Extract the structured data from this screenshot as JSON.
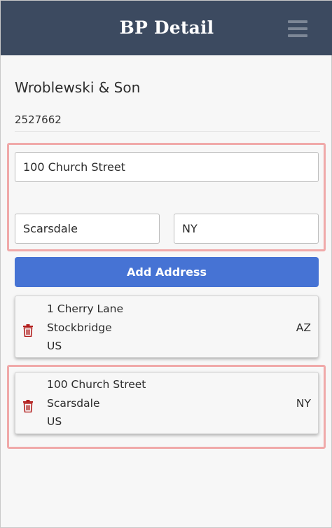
{
  "header": {
    "title": "BP Detail",
    "menu_icon": "hamburger-menu-icon",
    "background": "#3c4a60"
  },
  "business_partner": {
    "name": "Wroblewski & Son",
    "number": "2527662"
  },
  "form": {
    "street_value": "100 Church Street",
    "city_value": "Scarsdale",
    "state_value": "NY",
    "add_button_label": "Add Address",
    "button_color": "#4673d4"
  },
  "addresses": [
    {
      "street": "1 Cherry Lane",
      "city": "Stockbridge",
      "state": "AZ",
      "country": "US",
      "delete_icon": "trash-icon"
    },
    {
      "street": "100 Church Street",
      "city": "Scarsdale",
      "state": "NY",
      "country": "US",
      "delete_icon": "trash-icon"
    }
  ],
  "highlight_color": "#f0a9a9",
  "delete_color": "#b3201f"
}
